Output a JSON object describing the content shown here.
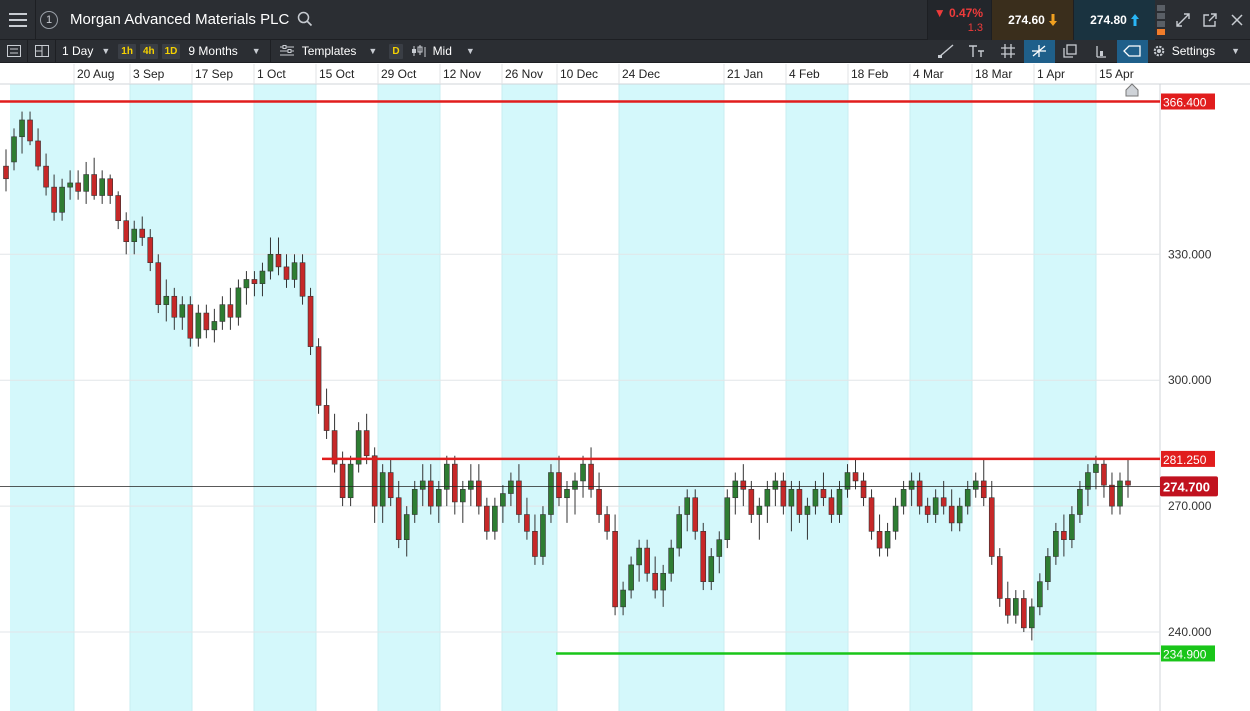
{
  "window": {
    "instrument_number": "1",
    "title": "Morgan Advanced Materials PLC",
    "change_pct": "▼ 0.47%",
    "change_abs": "1.3",
    "sell_price": "274.60",
    "buy_price": "274.80"
  },
  "toolbar": {
    "interval": "1 Day",
    "quick_intervals": [
      "1h",
      "4h",
      "1D"
    ],
    "range": "9 Months",
    "templates_label": "Templates",
    "chart_type_pill": "D",
    "price_mode": "Mid",
    "settings_label": "Settings"
  },
  "colors": {
    "up": "#2e7d32",
    "down": "#c62828",
    "resistance": "#e11d1d",
    "support": "#19c519",
    "band": "#d4f8fb",
    "current_price_bg": "#c1121f"
  },
  "chart_data": {
    "type": "candlestick",
    "title": "",
    "x_axis_labels": [
      "20 Aug",
      "3 Sep",
      "17 Sep",
      "1 Oct",
      "15 Oct",
      "29 Oct",
      "12 Nov",
      "26 Nov",
      "10 Dec",
      "24 Dec",
      "21 Jan",
      "4 Feb",
      "18 Feb",
      "4 Mar",
      "18 Mar",
      "1 Apr",
      "15 Apr"
    ],
    "y_axis_labels": [
      "330.000",
      "300.000",
      "270.000",
      "240.000"
    ],
    "ylim": [
      225,
      372
    ],
    "resistance_levels": [
      {
        "label": "366.400",
        "value": 366.4
      },
      {
        "label": "281.250",
        "value": 281.25
      }
    ],
    "support_levels": [
      {
        "label": "234.900",
        "value": 234.9
      }
    ],
    "current_price": {
      "label": "274.700",
      "value": 274.7
    },
    "grid": true,
    "candles": [
      [
        351,
        355,
        345,
        348
      ],
      [
        352,
        360,
        350,
        358
      ],
      [
        358,
        364,
        354,
        362
      ],
      [
        362,
        364,
        356,
        357
      ],
      [
        357,
        360,
        350,
        351
      ],
      [
        351,
        354,
        344,
        346
      ],
      [
        346,
        349,
        338,
        340
      ],
      [
        340,
        348,
        338,
        346
      ],
      [
        346,
        350,
        343,
        347
      ],
      [
        347,
        350,
        343,
        345
      ],
      [
        345,
        352,
        342,
        349
      ],
      [
        349,
        353,
        343,
        344
      ],
      [
        344,
        350,
        342,
        348
      ],
      [
        348,
        349,
        342,
        344
      ],
      [
        344,
        345,
        336,
        338
      ],
      [
        338,
        340,
        330,
        333
      ],
      [
        333,
        338,
        330,
        336
      ],
      [
        336,
        339,
        332,
        334
      ],
      [
        334,
        336,
        326,
        328
      ],
      [
        328,
        330,
        316,
        318
      ],
      [
        318,
        324,
        314,
        320
      ],
      [
        320,
        322,
        312,
        315
      ],
      [
        315,
        320,
        312,
        318
      ],
      [
        318,
        320,
        308,
        310
      ],
      [
        310,
        318,
        308,
        316
      ],
      [
        316,
        318,
        310,
        312
      ],
      [
        312,
        317,
        309,
        314
      ],
      [
        314,
        320,
        312,
        318
      ],
      [
        318,
        322,
        312,
        315
      ],
      [
        315,
        324,
        313,
        322
      ],
      [
        322,
        326,
        318,
        324
      ],
      [
        324,
        326,
        320,
        323
      ],
      [
        323,
        328,
        320,
        326
      ],
      [
        326,
        334,
        324,
        330
      ],
      [
        330,
        334,
        325,
        327
      ],
      [
        327,
        330,
        322,
        324
      ],
      [
        324,
        330,
        322,
        328
      ],
      [
        328,
        330,
        318,
        320
      ],
      [
        320,
        322,
        306,
        308
      ],
      [
        308,
        310,
        292,
        294
      ],
      [
        294,
        298,
        286,
        288
      ],
      [
        288,
        292,
        278,
        280
      ],
      [
        280,
        283,
        270,
        272
      ],
      [
        272,
        282,
        270,
        280
      ],
      [
        280,
        290,
        278,
        288
      ],
      [
        288,
        292,
        280,
        282
      ],
      [
        282,
        284,
        266,
        270
      ],
      [
        270,
        280,
        266,
        278
      ],
      [
        278,
        281,
        270,
        272
      ],
      [
        272,
        276,
        260,
        262
      ],
      [
        262,
        270,
        258,
        268
      ],
      [
        268,
        276,
        266,
        274
      ],
      [
        274,
        280,
        270,
        276
      ],
      [
        276,
        280,
        268,
        270
      ],
      [
        270,
        276,
        266,
        274
      ],
      [
        274,
        282,
        270,
        280
      ],
      [
        280,
        282,
        268,
        271
      ],
      [
        271,
        276,
        266,
        274
      ],
      [
        274,
        280,
        270,
        276
      ],
      [
        276,
        280,
        268,
        270
      ],
      [
        270,
        272,
        262,
        264
      ],
      [
        264,
        272,
        262,
        270
      ],
      [
        270,
        275,
        266,
        273
      ],
      [
        273,
        278,
        270,
        276
      ],
      [
        276,
        280,
        266,
        268
      ],
      [
        268,
        272,
        262,
        264
      ],
      [
        264,
        268,
        256,
        258
      ],
      [
        258,
        270,
        256,
        268
      ],
      [
        268,
        280,
        266,
        278
      ],
      [
        278,
        282,
        270,
        272
      ],
      [
        272,
        276,
        266,
        274
      ],
      [
        274,
        278,
        268,
        276
      ],
      [
        276,
        282,
        272,
        280
      ],
      [
        280,
        284,
        272,
        274
      ],
      [
        274,
        278,
        266,
        268
      ],
      [
        268,
        270,
        262,
        264
      ],
      [
        264,
        268,
        244,
        246
      ],
      [
        246,
        252,
        244,
        250
      ],
      [
        250,
        258,
        248,
        256
      ],
      [
        256,
        262,
        252,
        260
      ],
      [
        260,
        262,
        252,
        254
      ],
      [
        254,
        258,
        248,
        250
      ],
      [
        250,
        256,
        246,
        254
      ],
      [
        254,
        262,
        252,
        260
      ],
      [
        260,
        270,
        258,
        268
      ],
      [
        268,
        274,
        264,
        272
      ],
      [
        272,
        274,
        262,
        264
      ],
      [
        264,
        266,
        250,
        252
      ],
      [
        252,
        260,
        250,
        258
      ],
      [
        258,
        264,
        254,
        262
      ],
      [
        262,
        274,
        260,
        272
      ],
      [
        272,
        278,
        268,
        276
      ],
      [
        276,
        280,
        270,
        274
      ],
      [
        274,
        276,
        266,
        268
      ],
      [
        268,
        272,
        262,
        270
      ],
      [
        270,
        276,
        266,
        274
      ],
      [
        274,
        278,
        270,
        276
      ],
      [
        276,
        278,
        268,
        270
      ],
      [
        270,
        276,
        264,
        274
      ],
      [
        274,
        276,
        266,
        268
      ],
      [
        268,
        272,
        262,
        270
      ],
      [
        270,
        276,
        268,
        274
      ],
      [
        274,
        278,
        270,
        272
      ],
      [
        272,
        274,
        266,
        268
      ],
      [
        268,
        276,
        266,
        274
      ],
      [
        274,
        280,
        272,
        278
      ],
      [
        278,
        281,
        274,
        276
      ],
      [
        276,
        278,
        270,
        272
      ],
      [
        272,
        274,
        262,
        264
      ],
      [
        264,
        268,
        258,
        260
      ],
      [
        260,
        266,
        258,
        264
      ],
      [
        264,
        272,
        262,
        270
      ],
      [
        270,
        276,
        268,
        274
      ],
      [
        274,
        278,
        270,
        276
      ],
      [
        276,
        278,
        268,
        270
      ],
      [
        270,
        272,
        266,
        268
      ],
      [
        268,
        274,
        266,
        272
      ],
      [
        272,
        276,
        268,
        270
      ],
      [
        270,
        274,
        264,
        266
      ],
      [
        266,
        272,
        264,
        270
      ],
      [
        270,
        276,
        268,
        274
      ],
      [
        274,
        278,
        272,
        276
      ],
      [
        276,
        281,
        270,
        272
      ],
      [
        272,
        276,
        256,
        258
      ],
      [
        258,
        260,
        246,
        248
      ],
      [
        248,
        252,
        242,
        244
      ],
      [
        244,
        250,
        242,
        248
      ],
      [
        248,
        250,
        240,
        241
      ],
      [
        241,
        248,
        238,
        246
      ],
      [
        246,
        254,
        244,
        252
      ],
      [
        252,
        260,
        250,
        258
      ],
      [
        258,
        266,
        256,
        264
      ],
      [
        264,
        268,
        258,
        262
      ],
      [
        262,
        270,
        260,
        268
      ],
      [
        268,
        276,
        266,
        274
      ],
      [
        274,
        280,
        270,
        278
      ],
      [
        278,
        282,
        274,
        280
      ],
      [
        280,
        281,
        272,
        275
      ],
      [
        275,
        278,
        268,
        270
      ],
      [
        270,
        278,
        268,
        276
      ],
      [
        276,
        281,
        272,
        275
      ]
    ]
  }
}
